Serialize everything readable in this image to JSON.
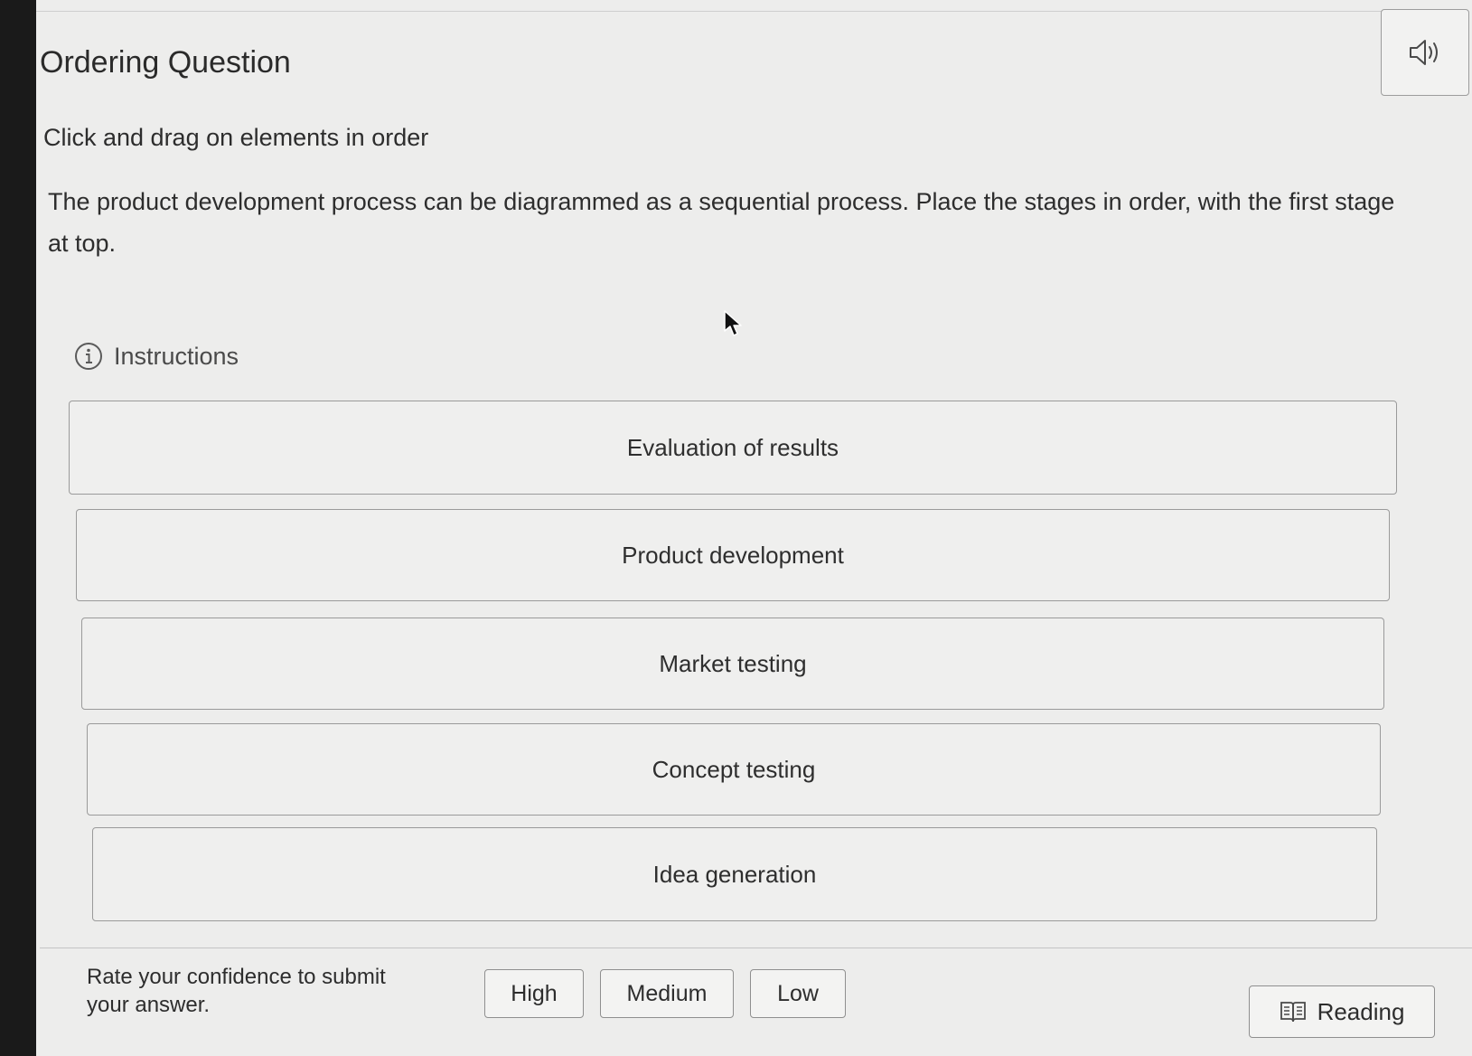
{
  "header": {
    "title": "Ordering Question",
    "audio_icon": "speaker-icon"
  },
  "question": {
    "subtitle": "Click and drag on elements in order",
    "prompt": "The product development process can be diagrammed as a sequential process. Place the stages in order, with the first stage at top."
  },
  "instructions": {
    "label": "Instructions",
    "icon": "info-icon"
  },
  "order_items": [
    {
      "label": "Evaluation of results"
    },
    {
      "label": "Product development"
    },
    {
      "label": "Market testing"
    },
    {
      "label": "Concept testing"
    },
    {
      "label": "Idea generation"
    }
  ],
  "footer": {
    "confidence_label": "Rate your confidence to submit your answer.",
    "buttons": {
      "high": "High",
      "medium": "Medium",
      "low": "Low"
    },
    "reading_label": "Reading",
    "reading_icon": "book-icon"
  }
}
